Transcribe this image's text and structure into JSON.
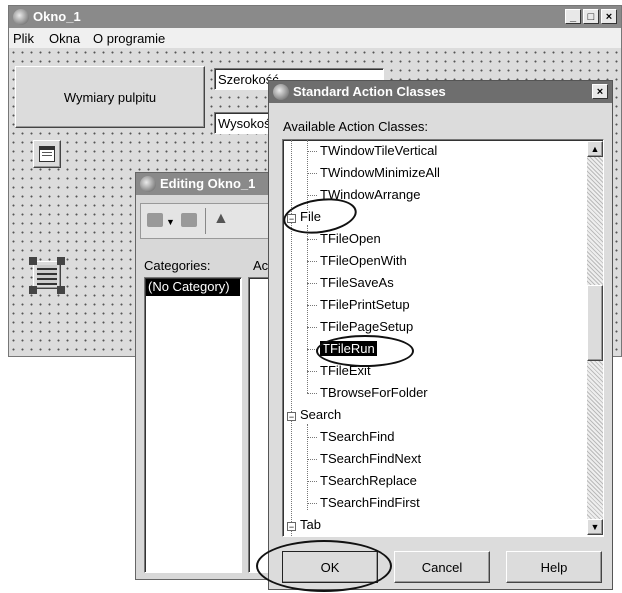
{
  "main_window": {
    "title": "Okno_1",
    "menu": [
      {
        "label": "Plik"
      },
      {
        "label": "Okna"
      },
      {
        "label": "O programie"
      }
    ],
    "button_label": "Wymiary pulpitu",
    "width_field": "Szerokość",
    "height_field": "Wysokość"
  },
  "caption_buttons": {
    "minimize": "_",
    "maximize": "□",
    "close": "×"
  },
  "editing_window": {
    "title": "Editing Okno_1",
    "categories_label": "Categories:",
    "actions_label": "Actions:",
    "categories": [
      "(No Category)"
    ]
  },
  "dialog": {
    "title": "Standard Action Classes",
    "close_glyph": "×",
    "list_label": "Available Action Classes:",
    "tree": [
      {
        "label": "TWindowTileVertical",
        "level": 1
      },
      {
        "label": "TWindowMinimizeAll",
        "level": 1
      },
      {
        "label": "TWindowArrange",
        "level": 1
      },
      {
        "label": "File",
        "level": 0
      },
      {
        "label": "TFileOpen",
        "level": 1
      },
      {
        "label": "TFileOpenWith",
        "level": 1
      },
      {
        "label": "TFileSaveAs",
        "level": 1
      },
      {
        "label": "TFilePrintSetup",
        "level": 1
      },
      {
        "label": "TFilePageSetup",
        "level": 1
      },
      {
        "label": "TFileRun",
        "level": 1
      },
      {
        "label": "TFileExit",
        "level": 1
      },
      {
        "label": "TBrowseForFolder",
        "level": 1
      },
      {
        "label": "Search",
        "level": 0
      },
      {
        "label": "TSearchFind",
        "level": 1
      },
      {
        "label": "TSearchFindNext",
        "level": 1
      },
      {
        "label": "TSearchReplace",
        "level": 1
      },
      {
        "label": "TSearchFindFirst",
        "level": 1
      },
      {
        "label": "Tab",
        "level": 0
      }
    ],
    "buttons": {
      "ok": "OK",
      "cancel": "Cancel",
      "help": "Help"
    }
  }
}
